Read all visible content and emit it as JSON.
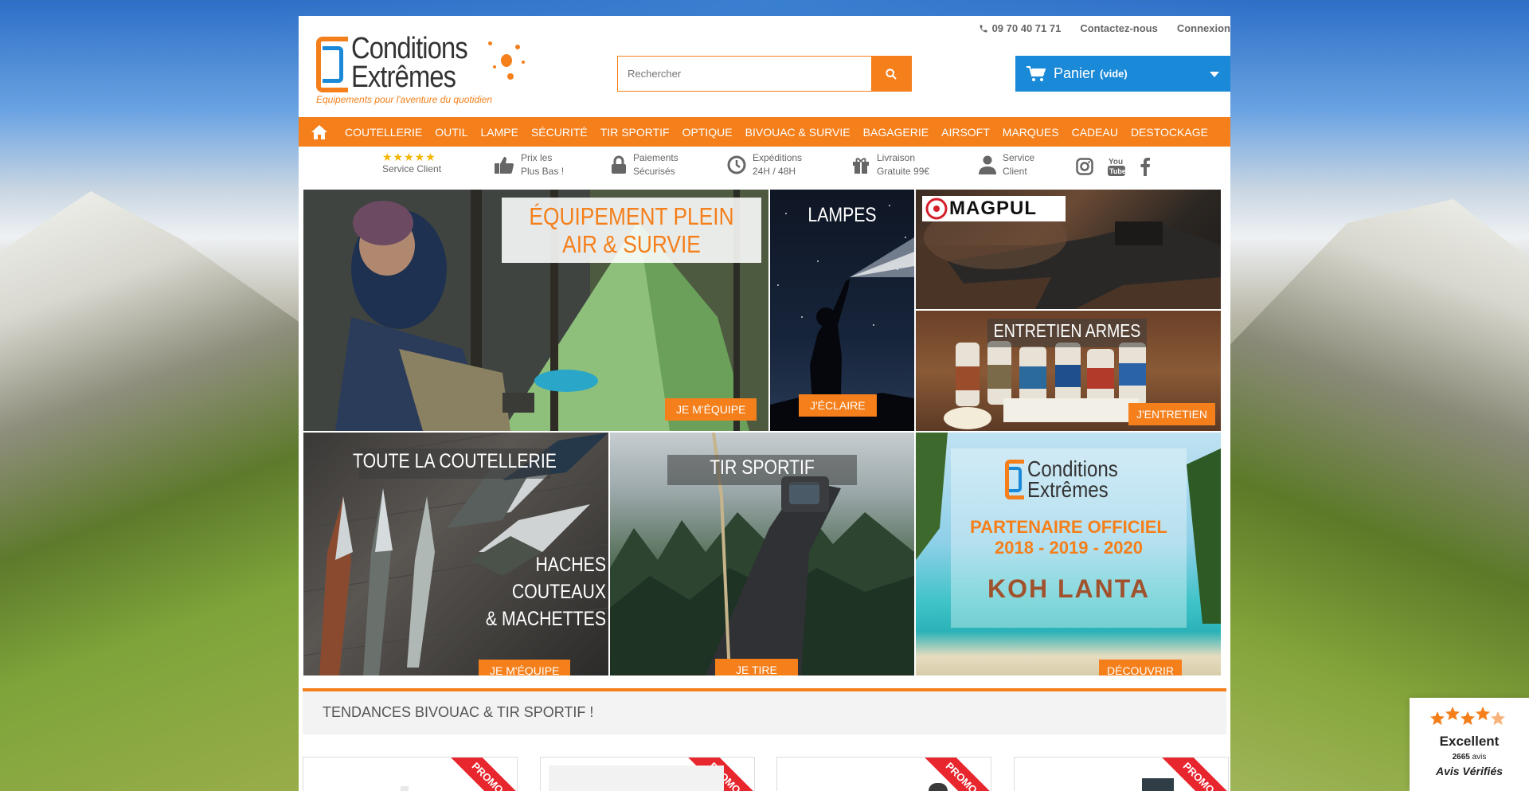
{
  "header": {
    "phone": "09 70 40 71 71",
    "contact_label": "Contactez-nous",
    "login_label": "Connexion",
    "logo_line1": "Conditions",
    "logo_line2": "Extrêmes",
    "logo_tagline": "Equipements pour l'aventure du quotidien",
    "search_placeholder": "Rechercher",
    "cart_label": "Panier",
    "cart_status": "(vide)"
  },
  "nav": {
    "items": [
      "COUTELLERIE",
      "OUTIL",
      "LAMPE",
      "SÉCURITÉ",
      "TIR SPORTIF",
      "OPTIQUE",
      "BIVOUAC & SURVIE",
      "BAGAGERIE",
      "AIRSOFT",
      "MARQUES",
      "CADEAU",
      "DESTOCKAGE"
    ]
  },
  "features": [
    {
      "line1": "★★★★★",
      "line2": "Service Client",
      "icon": "stars-icon"
    },
    {
      "line1": "Prix les",
      "line2": "Plus Bas !",
      "icon": "thumbs-up-icon"
    },
    {
      "line1": "Paiements",
      "line2": "Sécurisés",
      "icon": "lock-icon"
    },
    {
      "line1": "Expéditions",
      "line2": "24H / 48H",
      "icon": "clock-icon"
    },
    {
      "line1": "Livraison",
      "line2": "Gratuite 99€",
      "icon": "gift-icon"
    },
    {
      "line1": "Service",
      "line2": "Client",
      "icon": "user-icon"
    }
  ],
  "banners": {
    "camping_title": "ÉQUIPEMENT PLEIN AIR & SURVIE",
    "camping_button": "JE M'ÉQUIPE",
    "lamp_title": "LAMPES",
    "lamp_button": "J'ÉCLAIRE",
    "magpul_logo": "MAGPUL",
    "maintenance_title": "ENTRETIEN ARMES",
    "maintenance_button": "J'ENTRETIEN",
    "knives_title": "TOUTE LA COUTELLERIE",
    "knives_sub1": "HACHES",
    "knives_sub2": "COUTEAUX",
    "knives_sub3": "& MACHETTES",
    "knives_button": "JE M'ÉQUIPE",
    "shooting_title": "TIR SPORTIF",
    "shooting_button": "JE TIRE",
    "partner_line1": "Conditions",
    "partner_line2": "Extrêmes",
    "partner_title": "PARTENAIRE OFFICIEL",
    "partner_years": "2018 - 2019 - 2020",
    "partner_show": "KOH LANTA",
    "partner_button": "DÉCOUVRIR"
  },
  "trends": {
    "title": "TENDANCES BIVOUAC & TIR SPORTIF !",
    "promo_label": "PROMO"
  },
  "reviews": {
    "rating_label": "Excellent",
    "count_value": "2665",
    "count_unit": "avis",
    "brand": "Avis Vérifiés",
    "stars_value": 4.5
  },
  "colors": {
    "accent": "#f47f1b",
    "cart_blue": "#1a89d8",
    "promo_red": "#e8262e"
  }
}
